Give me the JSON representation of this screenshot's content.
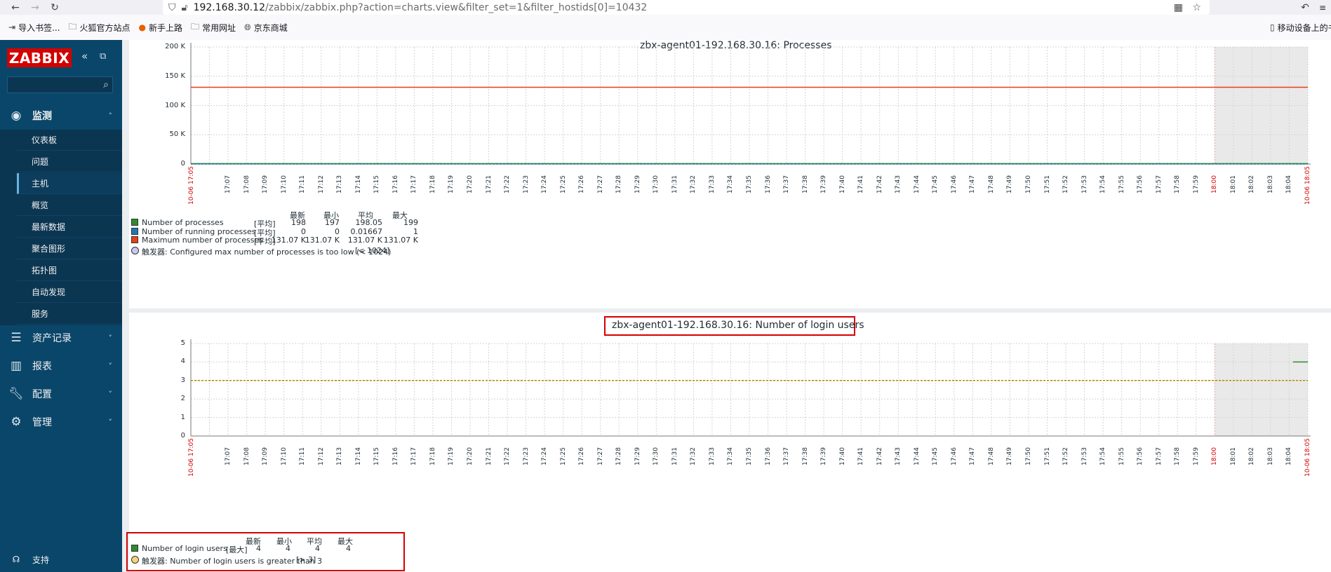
{
  "browser": {
    "url_host": "192.168.30.12",
    "url_path": "/zabbix/zabbix.php?action=charts.view&filter_set=1&filter_hostids[0]=10432",
    "bookmarks": [
      "导入书签...",
      "火狐官方站点",
      "新手上路",
      "常用网址",
      "京东商城"
    ],
    "mobile_bookmarks": "移动设备上的书"
  },
  "sidebar": {
    "logo": "ZABBIX",
    "monitoring": "监测",
    "monitoring_items": [
      "仪表板",
      "问题",
      "主机",
      "概览",
      "最新数据",
      "聚合图形",
      "拓扑图",
      "自动发现",
      "服务"
    ],
    "active_item": "主机",
    "inventory": "资产记录",
    "reports": "报表",
    "config": "配置",
    "admin": "管理",
    "support": "支持"
  },
  "colors": {
    "green": "#2e8b2e",
    "blue": "#1f77b4",
    "red": "#e83e1a",
    "yellow": "#f5d37a",
    "trigger": "#c8c8f0"
  },
  "chart_data": [
    {
      "type": "line",
      "title": "zbx-agent01-192.168.30.16: Processes",
      "yticks": [
        "0",
        "50 K",
        "100 K",
        "150 K",
        "200 K"
      ],
      "ylim": [
        0,
        200000
      ],
      "x_start_label": "10-06 17:05",
      "x_end_label": "10-06 18:05",
      "x_ticks": [
        "17:07",
        "17:08",
        "17:09",
        "17:10",
        "17:11",
        "17:12",
        "17:13",
        "17:14",
        "17:15",
        "17:16",
        "17:17",
        "17:18",
        "17:19",
        "17:20",
        "17:21",
        "17:22",
        "17:23",
        "17:24",
        "17:25",
        "17:26",
        "17:27",
        "17:28",
        "17:29",
        "17:30",
        "17:31",
        "17:32",
        "17:33",
        "17:34",
        "17:35",
        "17:36",
        "17:37",
        "17:38",
        "17:39",
        "17:40",
        "17:41",
        "17:42",
        "17:43",
        "17:44",
        "17:45",
        "17:46",
        "17:47",
        "17:48",
        "17:49",
        "17:50",
        "17:51",
        "17:52",
        "17:53",
        "17:54",
        "17:55",
        "17:56",
        "17:57",
        "17:58",
        "17:59",
        "18:00",
        "18:01",
        "18:02",
        "18:03",
        "18:04"
      ],
      "legend_headers": [
        "最新",
        "最小",
        "平均",
        "最大"
      ],
      "series": [
        {
          "name": "Number of processes",
          "func": "[平均]",
          "stats": [
            "198",
            "197",
            "198.05",
            "199"
          ],
          "value": 198
        },
        {
          "name": "Number of running processes",
          "func": "[平均]",
          "stats": [
            "0",
            "0",
            "0.01667",
            "1"
          ],
          "value": 0
        },
        {
          "name": "Maximum number of processes",
          "func": "[平均]",
          "stats": [
            "131.07 K",
            "131.07 K",
            "131.07 K",
            "131.07 K"
          ],
          "value": 131070
        }
      ],
      "trigger": {
        "label": "触发器: Configured max number of processes is too low (< 1024)",
        "value": "[< 1024]"
      }
    },
    {
      "type": "line",
      "title": "zbx-agent01-192.168.30.16: Number of login users",
      "yticks": [
        "0",
        "1",
        "2",
        "3",
        "4",
        "5"
      ],
      "ylim": [
        0,
        5
      ],
      "x_start_label": "10-06 17:05",
      "x_end_label": "10-06 18:05",
      "legend_headers": [
        "最新",
        "最小",
        "平均",
        "最大"
      ],
      "series": [
        {
          "name": "Number of login users",
          "func": "[最大]",
          "stats": [
            "4",
            "4",
            "4",
            "4"
          ],
          "value": 4
        }
      ],
      "trigger": {
        "label": "触发器: Number of login users is greater than 3",
        "value": "[> 3]",
        "threshold": 3
      }
    }
  ]
}
